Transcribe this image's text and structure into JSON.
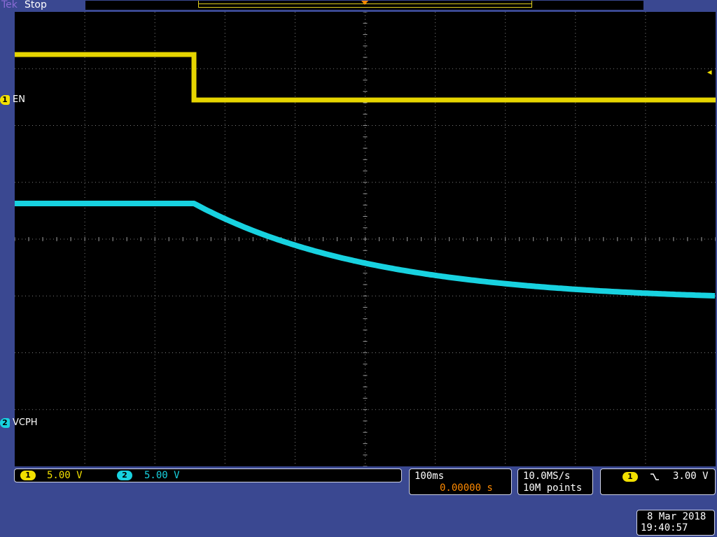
{
  "header": {
    "brand": "Tek",
    "run_state": "Stop"
  },
  "colors": {
    "background": "#3a4891",
    "ch1": "#f2e000",
    "ch2": "#18d2e0",
    "trigger_marker": "#ff8a00",
    "grid": "#7d7d7d"
  },
  "channels": [
    {
      "number": "1",
      "name": "EN",
      "scale": "5.00 V",
      "color": "#f2e000"
    },
    {
      "number": "2",
      "name": "VCPH",
      "scale": "5.00 V",
      "color": "#18d2e0"
    }
  ],
  "icons": {
    "trigger_level": "arrow-left-icon",
    "trigger_position": "triangle-down-icon",
    "trigger_slope": "falling-edge-icon"
  },
  "timebase": {
    "scale": "100ms",
    "position": "0.00000 s"
  },
  "acquisition": {
    "sample_rate": "10.0MS/s",
    "record_length": "10M points"
  },
  "trigger": {
    "source": "1",
    "level": "3.00 V"
  },
  "datetime": {
    "date": "8 Mar 2018",
    "time": "19:40:57"
  }
}
